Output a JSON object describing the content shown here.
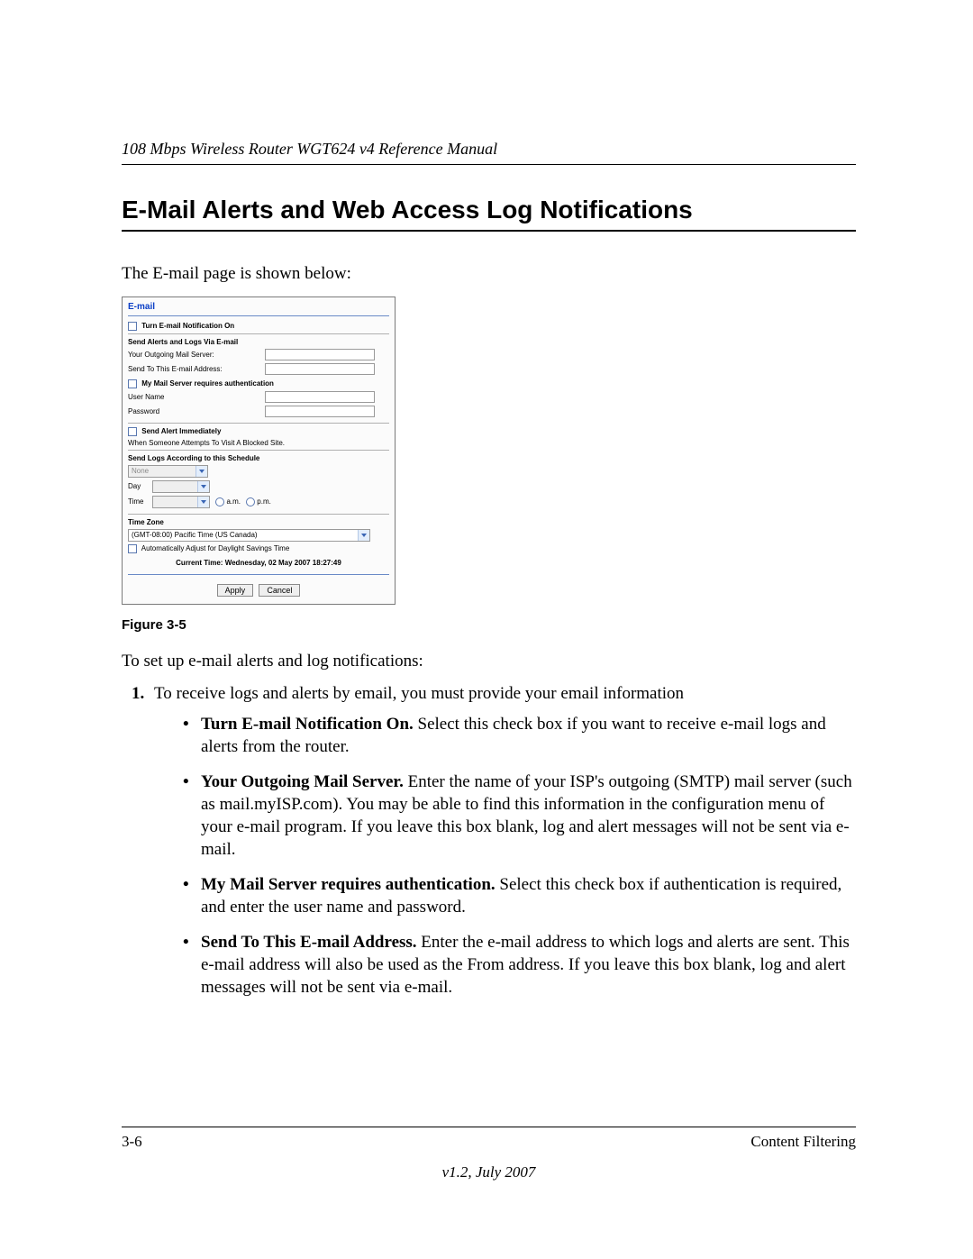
{
  "header": {
    "manual_title": "108 Mbps Wireless Router WGT624 v4 Reference Manual"
  },
  "section": {
    "title": "E-Mail Alerts and Web Access Log Notifications"
  },
  "intro": "The E-mail page is shown below:",
  "figure": {
    "panel_title": "E-mail",
    "turn_on_label": "Turn E-mail Notification On",
    "section_send": "Send Alerts and Logs Via E-mail",
    "outgoing_label": "Your Outgoing Mail Server:",
    "sendto_label": "Send To This E-mail Address:",
    "auth_label": "My Mail Server requires authentication",
    "user_label": "User Name",
    "pass_label": "Password",
    "alert_immediate": "Send Alert Immediately",
    "alert_sub": "When Someone Attempts To Visit A Blocked Site.",
    "schedule_header": "Send Logs According to this Schedule",
    "schedule_none": "None",
    "day_label": "Day",
    "time_label": "Time",
    "am": "a.m.",
    "pm": "p.m.",
    "tz_header": "Time Zone",
    "tz_value": "(GMT-08:00) Pacific Time (US Canada)",
    "dst_label": "Automatically Adjust for Daylight Savings Time",
    "current_time_label": "Current Time:",
    "current_time_value": "Wednesday, 02 May 2007 18:27:49",
    "apply": "Apply",
    "cancel": "Cancel",
    "caption": "Figure 3-5"
  },
  "instructions": {
    "lead": "To set up e-mail alerts and log notifications:",
    "step1": "To receive logs and alerts by email, you must provide your email information",
    "bullets": [
      {
        "title": "Turn E-mail Notification On.",
        "text": " Select this check box if you want to receive e-mail logs and alerts from the router."
      },
      {
        "title": "Your Outgoing Mail Server.",
        "text": " Enter the name of your ISP's outgoing (SMTP) mail server (such as mail.myISP.com). You may be able to find this information in the configuration menu of your e-mail program. If you leave this box blank, log and alert messages will not be sent via e-mail."
      },
      {
        "title": "My Mail Server requires authentication.",
        "text": " Select this check box if authentication is required, and enter the user name and password."
      },
      {
        "title": "Send To This E-mail Address.",
        "text": " Enter the e-mail address to which logs and alerts are sent. This e-mail address will also be used as the From address. If you leave this box blank, log and alert messages will not be sent via e-mail."
      }
    ]
  },
  "footer": {
    "page_number": "3-6",
    "chapter": "Content Filtering",
    "version": "v1.2, July 2007"
  }
}
